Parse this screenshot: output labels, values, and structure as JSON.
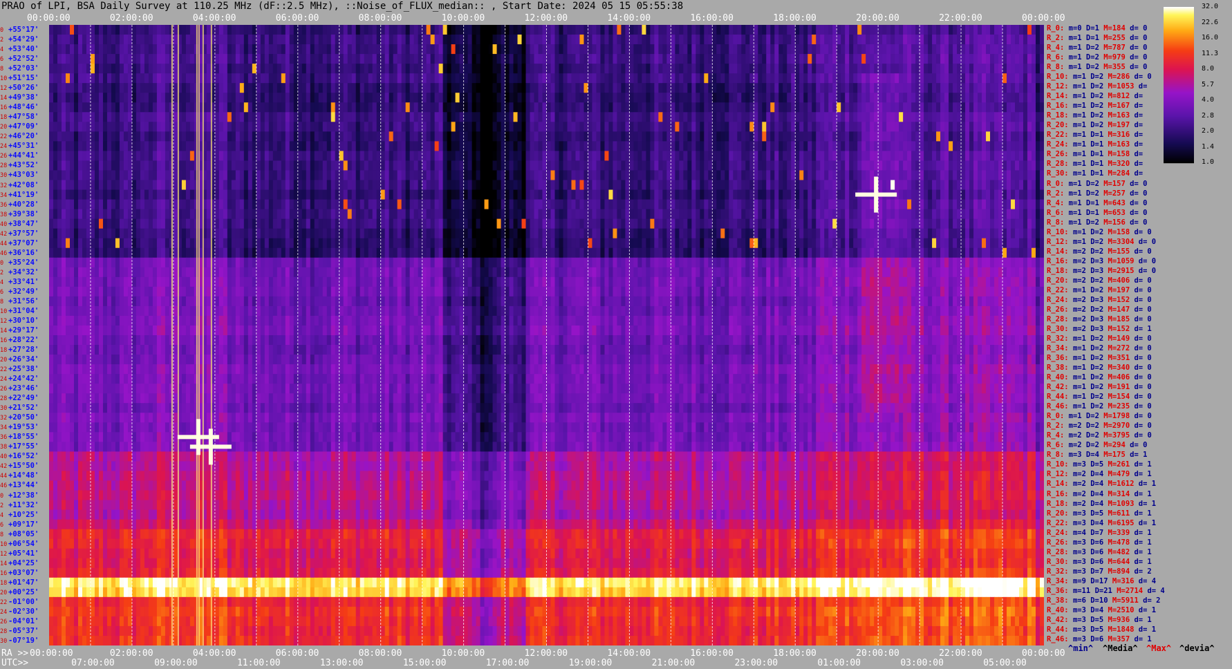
{
  "title": "PRAO of LPI, BSA Daily Survey at 110.25 MHz (dF::2.5 MHz), ::Noise_of_FLUX_median:: , Start Date: 2024 05 15 05:55:38",
  "axis_prefix": {
    "ra": "RA >>",
    "utc": "UTC>>"
  },
  "ra_ticks": [
    "00:00:00",
    "02:00:00",
    "04:00:00",
    "06:00:00",
    "08:00:00",
    "10:00:00",
    "12:00:00",
    "14:00:00",
    "16:00:00",
    "18:00:00",
    "20:00:00",
    "22:00:00",
    "00:00:00"
  ],
  "ra_bottom_ticks": [
    "00:00:00",
    "02:00:00",
    "04:00:00",
    "06:00:00",
    "08:00:00",
    "10:00:00",
    "12:00:00",
    "14:00:00",
    "16:00:00",
    "18:00:00",
    "20:00:00",
    "22:00:00",
    "00:00:00"
  ],
  "utc_ticks": [
    "07:00:00",
    "09:00:00",
    "11:00:00",
    "13:00:00",
    "15:00:00",
    "17:00:00",
    "19:00:00",
    "21:00:00",
    "23:00:00",
    "01:00:00",
    "03:00:00",
    "05:00:00"
  ],
  "footer_labels": {
    "min": "^min^",
    "median": "^Media^",
    "max": "^Max^",
    "dev": "^devia^"
  },
  "colorbar": {
    "labels": [
      "32.0",
      "22.6",
      "16.0",
      "11.3",
      "8.0",
      "5.7",
      "4.0",
      "2.8",
      "2.0",
      "1.4",
      "1.0"
    ],
    "scale": "log"
  },
  "chart_data": {
    "type": "heatmap",
    "title": "PRAO of LPI, BSA Daily Survey at 110.25 MHz (dF::2.5 MHz), ::Noise_of_FLUX_median:: , Start Date: 2024 05 15 05:55:38",
    "x_axis": "RA (00:00:00 to 24:00:00)",
    "colormap": "gnuplot-like (dark blue to purple to red to yellow to white)",
    "value_range": [
      1.0,
      32.0
    ],
    "rows": [
      {
        "idx": "0",
        "dec": "+55°17'"
      },
      {
        "idx": "2",
        "dec": "+54°29'"
      },
      {
        "idx": "4",
        "dec": "+53°40'"
      },
      {
        "idx": "6",
        "dec": "+52°52'"
      },
      {
        "idx": "8",
        "dec": "+52°03'"
      },
      {
        "idx": "10",
        "dec": "+51°15'"
      },
      {
        "idx": "12",
        "dec": "+50°26'"
      },
      {
        "idx": "14",
        "dec": "+49°38'"
      },
      {
        "idx": "16",
        "dec": "+48°46'"
      },
      {
        "idx": "18",
        "dec": "+47°58'"
      },
      {
        "idx": "20",
        "dec": "+47°09'"
      },
      {
        "idx": "22",
        "dec": "+46°20'"
      },
      {
        "idx": "24",
        "dec": "+45°31'"
      },
      {
        "idx": "26",
        "dec": "+44°41'"
      },
      {
        "idx": "28",
        "dec": "+43°52'"
      },
      {
        "idx": "30",
        "dec": "+43°03'"
      },
      {
        "idx": "32",
        "dec": "+42°08'"
      },
      {
        "idx": "34",
        "dec": "+41°19'"
      },
      {
        "idx": "36",
        "dec": "+40°28'"
      },
      {
        "idx": "38",
        "dec": "+39°38'"
      },
      {
        "idx": "40",
        "dec": "+38°47'"
      },
      {
        "idx": "42",
        "dec": "+37°57'"
      },
      {
        "idx": "44",
        "dec": "+37°07'"
      },
      {
        "idx": "46",
        "dec": "+36°16'"
      },
      {
        "idx": "0",
        "dec": "+35°24'"
      },
      {
        "idx": "2",
        "dec": "+34°32'"
      },
      {
        "idx": "4",
        "dec": "+33°41'"
      },
      {
        "idx": "6",
        "dec": "+32°49'"
      },
      {
        "idx": "8",
        "dec": "+31°56'"
      },
      {
        "idx": "10",
        "dec": "+31°04'"
      },
      {
        "idx": "12",
        "dec": "+30°10'"
      },
      {
        "idx": "14",
        "dec": "+29°17'"
      },
      {
        "idx": "16",
        "dec": "+28°22'"
      },
      {
        "idx": "18",
        "dec": "+27°28'"
      },
      {
        "idx": "20",
        "dec": "+26°34'"
      },
      {
        "idx": "22",
        "dec": "+25°38'"
      },
      {
        "idx": "24",
        "dec": "+24°42'"
      },
      {
        "idx": "26",
        "dec": "+23°46'"
      },
      {
        "idx": "28",
        "dec": "+22°49'"
      },
      {
        "idx": "30",
        "dec": "+21°52'"
      },
      {
        "idx": "32",
        "dec": "+20°50'"
      },
      {
        "idx": "34",
        "dec": "+19°53'"
      },
      {
        "idx": "36",
        "dec": "+18°55'"
      },
      {
        "idx": "38",
        "dec": "+17°55'"
      },
      {
        "idx": "40",
        "dec": "+16°52'"
      },
      {
        "idx": "42",
        "dec": "+15°50'"
      },
      {
        "idx": "44",
        "dec": "+14°48'"
      },
      {
        "idx": "46",
        "dec": "+13°44'"
      },
      {
        "idx": "0",
        "dec": "+12°38'"
      },
      {
        "idx": "2",
        "dec": "+11°32'"
      },
      {
        "idx": "4",
        "dec": "+10°25'"
      },
      {
        "idx": "6",
        "dec": "+09°17'"
      },
      {
        "idx": "8",
        "dec": "+08°05'"
      },
      {
        "idx": "10",
        "dec": "+06°54'"
      },
      {
        "idx": "12",
        "dec": "+05°41'"
      },
      {
        "idx": "14",
        "dec": "+04°25'"
      },
      {
        "idx": "16",
        "dec": "+03°07'"
      },
      {
        "idx": "18",
        "dec": "+01°47'"
      },
      {
        "idx": "20",
        "dec": "+00°25'"
      },
      {
        "idx": "22",
        "dec": "-01°00'"
      },
      {
        "idx": "24",
        "dec": "-02°30'"
      },
      {
        "idx": "26",
        "dec": "-04°01'"
      },
      {
        "idx": "28",
        "dec": "-05°37'"
      },
      {
        "idx": "30",
        "dec": "-07°19'"
      }
    ],
    "bright_sources_ra_hours": [
      3.6,
      3.9,
      19.95
    ],
    "stats": [
      {
        "r": "R_0:",
        "m": "m=0",
        "d": "D=1",
        "mx": "M=184",
        "dv": "d= 0"
      },
      {
        "r": "R_2:",
        "m": "m=1",
        "d": "D=1",
        "mx": "M=255",
        "dv": "d= 0"
      },
      {
        "r": "R_4:",
        "m": "m=1",
        "d": "D=2",
        "mx": "M=787",
        "dv": "d= 0"
      },
      {
        "r": "R_6:",
        "m": "m=1",
        "d": "D=2",
        "mx": "M=979",
        "dv": "d= 0"
      },
      {
        "r": "R_8:",
        "m": "m=1",
        "d": "D=2",
        "mx": "M=355",
        "dv": "d= 0"
      },
      {
        "r": "R_10:",
        "m": "m=1",
        "d": "D=2",
        "mx": "M=286",
        "dv": "d= 0"
      },
      {
        "r": "R_12:",
        "m": "m=1",
        "d": "D=2",
        "mx": "M=1053",
        "dv": "d="
      },
      {
        "r": "R_14:",
        "m": "m=1",
        "d": "D=2",
        "mx": "M=812",
        "dv": "d="
      },
      {
        "r": "R_16:",
        "m": "m=1",
        "d": "D=2",
        "mx": "M=167",
        "dv": "d="
      },
      {
        "r": "R_18:",
        "m": "m=1",
        "d": "D=2",
        "mx": "M=163",
        "dv": "d="
      },
      {
        "r": "R_20:",
        "m": "m=1",
        "d": "D=2",
        "mx": "M=197",
        "dv": "d="
      },
      {
        "r": "R_22:",
        "m": "m=1",
        "d": "D=1",
        "mx": "M=316",
        "dv": "d="
      },
      {
        "r": "R_24:",
        "m": "m=1",
        "d": "D=1",
        "mx": "M=163",
        "dv": "d="
      },
      {
        "r": "R_26:",
        "m": "m=1",
        "d": "D=1",
        "mx": "M=158",
        "dv": "d="
      },
      {
        "r": "R_28:",
        "m": "m=1",
        "d": "D=1",
        "mx": "M=320",
        "dv": "d="
      },
      {
        "r": "R_30:",
        "m": "m=1",
        "d": "D=1",
        "mx": "M=284",
        "dv": "d="
      },
      {
        "r": "R_0:",
        "m": "m=1",
        "d": "D=2",
        "mx": "M=157",
        "dv": "d= 0"
      },
      {
        "r": "R_2:",
        "m": "m=1",
        "d": "D=2",
        "mx": "M=257",
        "dv": "d= 0"
      },
      {
        "r": "R_4:",
        "m": "m=1",
        "d": "D=1",
        "mx": "M=643",
        "dv": "d= 0"
      },
      {
        "r": "R_6:",
        "m": "m=1",
        "d": "D=1",
        "mx": "M=653",
        "dv": "d= 0"
      },
      {
        "r": "R_8:",
        "m": "m=1",
        "d": "D=2",
        "mx": "M=156",
        "dv": "d= 0"
      },
      {
        "r": "R_10:",
        "m": "m=1",
        "d": "D=2",
        "mx": "M=158",
        "dv": "d= 0"
      },
      {
        "r": "R_12:",
        "m": "m=1",
        "d": "D=2",
        "mx": "M=3304",
        "dv": "d= 0"
      },
      {
        "r": "R_14:",
        "m": "m=2",
        "d": "D=2",
        "mx": "M=155",
        "dv": "d= 0"
      },
      {
        "r": "R_16:",
        "m": "m=2",
        "d": "D=3",
        "mx": "M=1059",
        "dv": "d= 0"
      },
      {
        "r": "R_18:",
        "m": "m=2",
        "d": "D=3",
        "mx": "M=2915",
        "dv": "d= 0"
      },
      {
        "r": "R_20:",
        "m": "m=2",
        "d": "D=2",
        "mx": "M=406",
        "dv": "d= 0"
      },
      {
        "r": "R_22:",
        "m": "m=1",
        "d": "D=2",
        "mx": "M=197",
        "dv": "d= 0"
      },
      {
        "r": "R_24:",
        "m": "m=2",
        "d": "D=3",
        "mx": "M=152",
        "dv": "d= 0"
      },
      {
        "r": "R_26:",
        "m": "m=2",
        "d": "D=2",
        "mx": "M=147",
        "dv": "d= 0"
      },
      {
        "r": "R_28:",
        "m": "m=2",
        "d": "D=3",
        "mx": "M=185",
        "dv": "d= 0"
      },
      {
        "r": "R_30:",
        "m": "m=2",
        "d": "D=3",
        "mx": "M=152",
        "dv": "d= 1"
      },
      {
        "r": "R_32:",
        "m": "m=1",
        "d": "D=2",
        "mx": "M=149",
        "dv": "d= 0"
      },
      {
        "r": "R_34:",
        "m": "m=1",
        "d": "D=2",
        "mx": "M=272",
        "dv": "d= 0"
      },
      {
        "r": "R_36:",
        "m": "m=1",
        "d": "D=2",
        "mx": "M=351",
        "dv": "d= 0"
      },
      {
        "r": "R_38:",
        "m": "m=1",
        "d": "D=2",
        "mx": "M=340",
        "dv": "d= 0"
      },
      {
        "r": "R_40:",
        "m": "m=1",
        "d": "D=2",
        "mx": "M=406",
        "dv": "d= 0"
      },
      {
        "r": "R_42:",
        "m": "m=1",
        "d": "D=2",
        "mx": "M=191",
        "dv": "d= 0"
      },
      {
        "r": "R_44:",
        "m": "m=1",
        "d": "D=2",
        "mx": "M=154",
        "dv": "d= 0"
      },
      {
        "r": "R_46:",
        "m": "m=1",
        "d": "D=2",
        "mx": "M=235",
        "dv": "d= 0"
      },
      {
        "r": "R_0:",
        "m": "m=1",
        "d": "D=2",
        "mx": "M=1798",
        "dv": "d= 0"
      },
      {
        "r": "R_2:",
        "m": "m=2",
        "d": "D=2",
        "mx": "M=2970",
        "dv": "d= 0"
      },
      {
        "r": "R_4:",
        "m": "m=2",
        "d": "D=2",
        "mx": "M=3795",
        "dv": "d= 0"
      },
      {
        "r": "R_6:",
        "m": "m=2",
        "d": "D=2",
        "mx": "M=294",
        "dv": "d= 0"
      },
      {
        "r": "R_8:",
        "m": "m=3",
        "d": "D=4",
        "mx": "M=175",
        "dv": "d= 1"
      },
      {
        "r": "R_10:",
        "m": "m=3",
        "d": "D=5",
        "mx": "M=261",
        "dv": "d= 1"
      },
      {
        "r": "R_12:",
        "m": "m=2",
        "d": "D=4",
        "mx": "M=479",
        "dv": "d= 1"
      },
      {
        "r": "R_14:",
        "m": "m=2",
        "d": "D=4",
        "mx": "M=1612",
        "dv": "d= 1"
      },
      {
        "r": "R_16:",
        "m": "m=2",
        "d": "D=4",
        "mx": "M=314",
        "dv": "d= 1"
      },
      {
        "r": "R_18:",
        "m": "m=2",
        "d": "D=4",
        "mx": "M=1093",
        "dv": "d= 1"
      },
      {
        "r": "R_20:",
        "m": "m=3",
        "d": "D=5",
        "mx": "M=611",
        "dv": "d= 1"
      },
      {
        "r": "R_22:",
        "m": "m=3",
        "d": "D=4",
        "mx": "M=6195",
        "dv": "d= 1"
      },
      {
        "r": "R_24:",
        "m": "m=4",
        "d": "D=7",
        "mx": "M=339",
        "dv": "d= 1"
      },
      {
        "r": "R_26:",
        "m": "m=3",
        "d": "D=6",
        "mx": "M=478",
        "dv": "d= 1"
      },
      {
        "r": "R_28:",
        "m": "m=3",
        "d": "D=6",
        "mx": "M=482",
        "dv": "d= 1"
      },
      {
        "r": "R_30:",
        "m": "m=3",
        "d": "D=6",
        "mx": "M=644",
        "dv": "d= 1"
      },
      {
        "r": "R_32:",
        "m": "m=3",
        "d": "D=7",
        "mx": "M=894",
        "dv": "d= 2"
      },
      {
        "r": "R_34:",
        "m": "m=9",
        "d": "D=17",
        "mx": "M=316",
        "dv": "d= 4"
      },
      {
        "r": "R_36:",
        "m": "m=11",
        "d": "D=21",
        "mx": "M=2714",
        "dv": "d= 4"
      },
      {
        "r": "R_38:",
        "m": "m=6",
        "d": "D=10",
        "mx": "M=5911",
        "dv": "d= 2"
      },
      {
        "r": "R_40:",
        "m": "m=3",
        "d": "D=4",
        "mx": "M=2510",
        "dv": "d= 1"
      },
      {
        "r": "R_42:",
        "m": "m=3",
        "d": "D=5",
        "mx": "M=936",
        "dv": "d= 1"
      },
      {
        "r": "R_44:",
        "m": "m=3",
        "d": "D=5",
        "mx": "M=1848",
        "dv": "d= 1"
      },
      {
        "r": "R_46:",
        "m": "m=3",
        "d": "D=6",
        "mx": "M=357",
        "dv": "d= 1"
      }
    ]
  }
}
